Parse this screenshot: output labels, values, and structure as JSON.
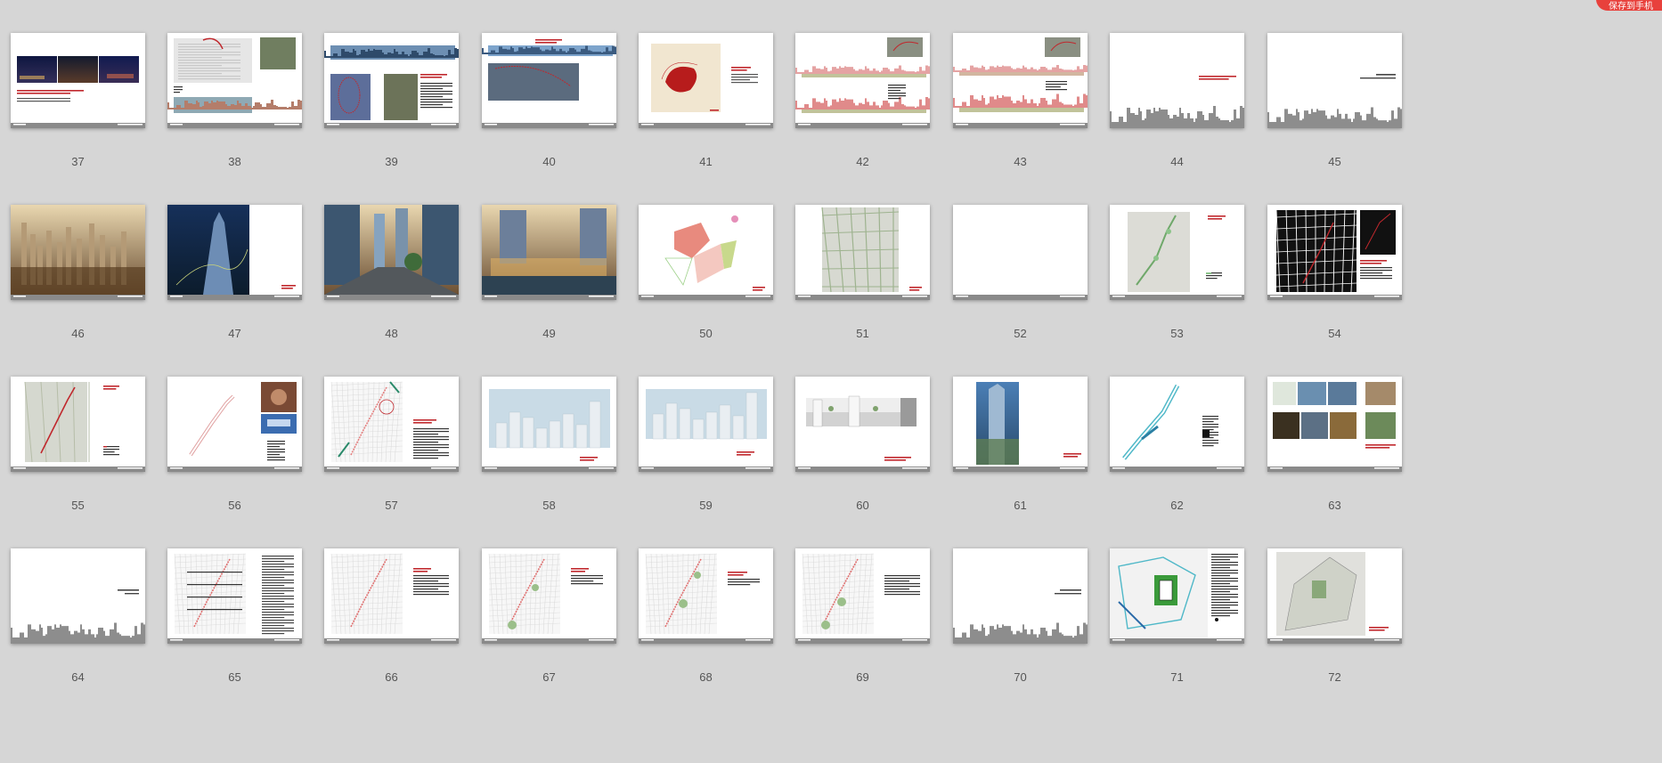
{
  "corner_badge": {
    "label": "保存到手机",
    "color": "#e8413c"
  },
  "colors": {
    "accent_red": "#c0282d",
    "footer_gray": "#8a8a8a",
    "background": "#d6d6d6"
  },
  "slides": [
    {
      "number": "37",
      "kind": "photo-strip"
    },
    {
      "number": "38",
      "kind": "aerial-panorama"
    },
    {
      "number": "39",
      "kind": "skyline-maps"
    },
    {
      "number": "40",
      "kind": "skyline-maps-b"
    },
    {
      "number": "41",
      "kind": "red-blob-map"
    },
    {
      "number": "42",
      "kind": "skyline-elevation"
    },
    {
      "number": "43",
      "kind": "skyline-elevation-b"
    },
    {
      "number": "44",
      "kind": "section-divider"
    },
    {
      "number": "45",
      "kind": "section-divider-b"
    },
    {
      "number": "46",
      "kind": "render-warm"
    },
    {
      "number": "47",
      "kind": "render-night-half"
    },
    {
      "number": "48",
      "kind": "render-street"
    },
    {
      "number": "49",
      "kind": "render-dusk"
    },
    {
      "number": "50",
      "kind": "plan-colored"
    },
    {
      "number": "51",
      "kind": "green-map"
    },
    {
      "number": "52",
      "kind": "table"
    },
    {
      "number": "53",
      "kind": "green-map-b"
    },
    {
      "number": "54",
      "kind": "figure-ground"
    },
    {
      "number": "55",
      "kind": "map-red-line"
    },
    {
      "number": "56",
      "kind": "line-plan-photos"
    },
    {
      "number": "57",
      "kind": "line-plan-red"
    },
    {
      "number": "58",
      "kind": "towers-elevation"
    },
    {
      "number": "59",
      "kind": "towers-elevation-b"
    },
    {
      "number": "60",
      "kind": "section-drawing"
    },
    {
      "number": "61",
      "kind": "tower-render"
    },
    {
      "number": "62",
      "kind": "plan-cyan"
    },
    {
      "number": "63",
      "kind": "photo-grid"
    },
    {
      "number": "64",
      "kind": "section-divider-c"
    },
    {
      "number": "65",
      "kind": "line-plan-text"
    },
    {
      "number": "66",
      "kind": "line-plan-text-b"
    },
    {
      "number": "67",
      "kind": "line-plan-green"
    },
    {
      "number": "68",
      "kind": "line-plan-green-b"
    },
    {
      "number": "69",
      "kind": "line-plan-green-c"
    },
    {
      "number": "70",
      "kind": "section-divider-d"
    },
    {
      "number": "71",
      "kind": "site-plan-color"
    },
    {
      "number": "72",
      "kind": "site-plan-gray"
    }
  ]
}
